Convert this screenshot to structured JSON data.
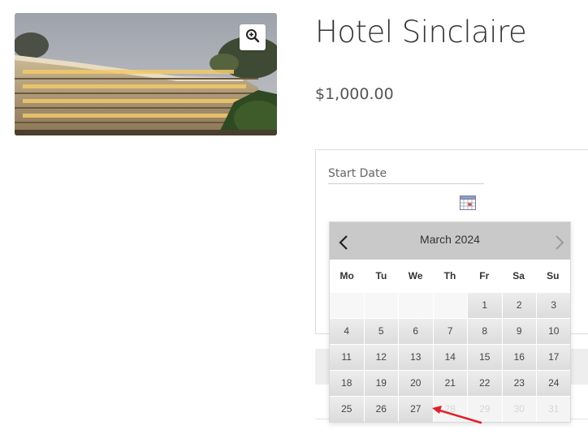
{
  "product": {
    "title": "Hotel Sinclaire",
    "price": "$1,000.00"
  },
  "booking": {
    "start_date_label": "Start Date",
    "start_date_value": ""
  },
  "datepicker": {
    "month_label": "March 2024",
    "weekdays": [
      "Mo",
      "Tu",
      "We",
      "Th",
      "Fr",
      "Sa",
      "Su"
    ],
    "weeks": [
      [
        {
          "day": "",
          "state": "empty"
        },
        {
          "day": "",
          "state": "empty"
        },
        {
          "day": "",
          "state": "empty"
        },
        {
          "day": "",
          "state": "empty"
        },
        {
          "day": "1",
          "state": "available"
        },
        {
          "day": "2",
          "state": "available"
        },
        {
          "day": "3",
          "state": "available"
        }
      ],
      [
        {
          "day": "4",
          "state": "available"
        },
        {
          "day": "5",
          "state": "available"
        },
        {
          "day": "6",
          "state": "available"
        },
        {
          "day": "7",
          "state": "available"
        },
        {
          "day": "8",
          "state": "available"
        },
        {
          "day": "9",
          "state": "available"
        },
        {
          "day": "10",
          "state": "available"
        }
      ],
      [
        {
          "day": "11",
          "state": "available"
        },
        {
          "day": "12",
          "state": "available"
        },
        {
          "day": "13",
          "state": "available"
        },
        {
          "day": "14",
          "state": "available"
        },
        {
          "day": "15",
          "state": "available"
        },
        {
          "day": "16",
          "state": "available"
        },
        {
          "day": "17",
          "state": "available"
        }
      ],
      [
        {
          "day": "18",
          "state": "available"
        },
        {
          "day": "19",
          "state": "available"
        },
        {
          "day": "20",
          "state": "available"
        },
        {
          "day": "21",
          "state": "available"
        },
        {
          "day": "22",
          "state": "available"
        },
        {
          "day": "23",
          "state": "available"
        },
        {
          "day": "24",
          "state": "available"
        }
      ],
      [
        {
          "day": "25",
          "state": "available"
        },
        {
          "day": "26",
          "state": "available"
        },
        {
          "day": "27",
          "state": "available"
        },
        {
          "day": "28",
          "state": "disabled"
        },
        {
          "day": "29",
          "state": "disabled"
        },
        {
          "day": "30",
          "state": "disabled"
        },
        {
          "day": "31",
          "state": "disabled"
        }
      ]
    ]
  },
  "icons": {
    "zoom": "zoom-in-icon",
    "calendar": "calendar-icon",
    "prev": "chevron-left-icon",
    "next": "chevron-right-icon"
  },
  "colors": {
    "annotation_arrow": "#e0202a",
    "datepicker_header": "#c9c9c9"
  }
}
